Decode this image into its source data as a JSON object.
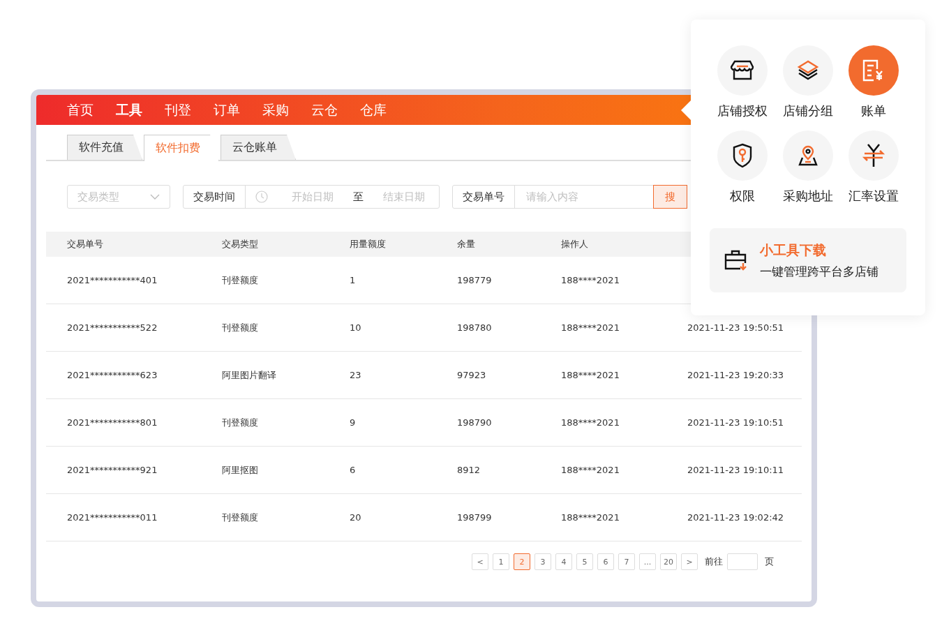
{
  "nav": [
    {
      "label": "首页",
      "selected": false
    },
    {
      "label": "工具",
      "selected": true
    },
    {
      "label": "刊登",
      "selected": false
    },
    {
      "label": "订单",
      "selected": false
    },
    {
      "label": "采购",
      "selected": false
    },
    {
      "label": "云仓",
      "selected": false
    },
    {
      "label": "仓库",
      "selected": false
    }
  ],
  "tabs": [
    {
      "label": "软件充值",
      "selected": false
    },
    {
      "label": "软件扣费",
      "selected": true
    },
    {
      "label": "云仓账单",
      "selected": false
    }
  ],
  "filters": {
    "type_select": {
      "placeholder": "交易类型"
    },
    "time_label": "交易时间",
    "start_date": {
      "placeholder": "开始日期"
    },
    "range_separator": "至",
    "end_date": {
      "placeholder": "结束日期"
    },
    "order_label": "交易单号",
    "order_input": {
      "placeholder": "请输入内容"
    },
    "search_button": "搜"
  },
  "table": {
    "columns": [
      "交易单号",
      "交易类型",
      "用量额度",
      "余量",
      "操作人"
    ],
    "rows": [
      [
        "2021***********401",
        "刊登额度",
        "1",
        "198779",
        "188****2021"
      ],
      [
        "2021***********522",
        "刊登额度",
        "10",
        "198780",
        "188****2021",
        "2021-11-23 19:50:51"
      ],
      [
        "2021***********623",
        "阿里图片翻译",
        "23",
        "97923",
        "188****2021",
        "2021-11-23 19:20:33"
      ],
      [
        "2021***********801",
        "刊登额度",
        "9",
        "198790",
        "188****2021",
        "2021-11-23 19:10:51"
      ],
      [
        "2021***********921",
        "阿里抠图",
        "6",
        "8912",
        "188****2021",
        "2021-11-23 19:10:11"
      ],
      [
        "2021***********011",
        "刊登额度",
        "20",
        "198799",
        "188****2021",
        "2021-11-23 19:02:42"
      ]
    ]
  },
  "pagination": {
    "prev": "<",
    "next": ">",
    "pages": [
      {
        "label": "1",
        "selected": false
      },
      {
        "label": "2",
        "selected": true
      },
      {
        "label": "3",
        "selected": false
      },
      {
        "label": "4",
        "selected": false
      },
      {
        "label": "5",
        "selected": false
      },
      {
        "label": "6",
        "selected": false
      },
      {
        "label": "7",
        "selected": false
      },
      {
        "label": "...",
        "selected": false
      },
      {
        "label": "20",
        "selected": false
      }
    ],
    "goto_label": "前往",
    "page_suffix": "页"
  },
  "tools_menu": {
    "items": [
      {
        "kind": "store",
        "label": "店铺授权",
        "selected": false
      },
      {
        "kind": "layers",
        "label": "店铺分组",
        "selected": false
      },
      {
        "kind": "bill",
        "label": "账单",
        "selected": true
      },
      {
        "kind": "shield",
        "label": "权限",
        "selected": false
      },
      {
        "kind": "location",
        "label": "采购地址",
        "selected": false
      },
      {
        "kind": "exchange",
        "label": "汇率设置",
        "selected": false
      }
    ],
    "promo": {
      "title": "小工具下载",
      "subtitle": "一键管理跨平台多店铺"
    }
  }
}
